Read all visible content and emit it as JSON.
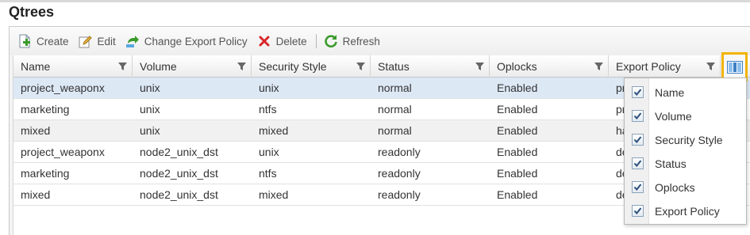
{
  "page": {
    "title": "Qtrees"
  },
  "toolbar": {
    "create": "Create",
    "edit": "Edit",
    "change_export_policy": "Change Export Policy",
    "delete": "Delete",
    "refresh": "Refresh"
  },
  "table": {
    "columns": [
      "Name",
      "Volume",
      "Security Style",
      "Status",
      "Oplocks",
      "Export Policy"
    ],
    "rows": [
      [
        "project_weaponx",
        "unix",
        "unix",
        "normal",
        "Enabled",
        "pr"
      ],
      [
        "marketing",
        "unix",
        "ntfs",
        "normal",
        "Enabled",
        "pr"
      ],
      [
        "mixed",
        "unix",
        "mixed",
        "normal",
        "Enabled",
        "ha"
      ],
      [
        "project_weaponx",
        "node2_unix_dst",
        "unix",
        "readonly",
        "Enabled",
        "de"
      ],
      [
        "marketing",
        "node2_unix_dst",
        "ntfs",
        "readonly",
        "Enabled",
        "de"
      ],
      [
        "mixed",
        "node2_unix_dst",
        "mixed",
        "readonly",
        "Enabled",
        "de"
      ]
    ],
    "selected_row": 0
  },
  "column_menu": {
    "items": [
      {
        "label": "Name",
        "checked": true
      },
      {
        "label": "Volume",
        "checked": true
      },
      {
        "label": "Security Style",
        "checked": true
      },
      {
        "label": "Status",
        "checked": true
      },
      {
        "label": "Oplocks",
        "checked": true
      },
      {
        "label": "Export Policy",
        "checked": true
      }
    ]
  },
  "colors": {
    "highlight": "#f2b300",
    "selected_row": "#dde8f5",
    "delete_red": "#d8262b",
    "add_green": "#3a9b2a"
  },
  "icons": {
    "create": "create-icon",
    "edit": "edit-icon",
    "change_export_policy": "export-policy-icon",
    "delete": "delete-icon",
    "refresh": "refresh-icon",
    "filter": "filter-icon",
    "column_chooser": "column-chooser-icon",
    "checkbox": "checkbox-checked-icon"
  }
}
